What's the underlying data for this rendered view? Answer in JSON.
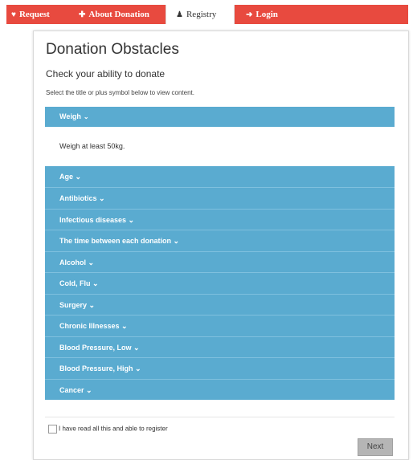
{
  "nav": {
    "items": [
      {
        "label": "Request",
        "icon": "heart-badge-icon"
      },
      {
        "label": "About Donation",
        "icon": "syringe-icon"
      },
      {
        "label": "Registry",
        "icon": "user-icon"
      },
      {
        "label": "Login",
        "icon": "login-icon"
      }
    ],
    "active": "Registry",
    "bar_color": "#e84a3f"
  },
  "page": {
    "title": "Donation Obstacles",
    "subtitle": "Check your ability to donate",
    "instruction": "Select the title or plus symbol below to view content."
  },
  "accordion": {
    "header_color": "#5aabd0",
    "expanded": {
      "title": "Weigh",
      "content": "Weigh at least 50kg."
    },
    "items": [
      "Age",
      "Antibiotics",
      "Infectious diseases",
      "The time between each donation",
      "Alcohol",
      "Cold, Flu",
      "Surgery",
      "Chronic Illnesses",
      "Blood Pressure, Low",
      "Blood Pressure, High",
      "Cancer"
    ]
  },
  "footer": {
    "checkbox_label": "I have read all this and able to register",
    "checked": false,
    "next_label": "Next"
  }
}
